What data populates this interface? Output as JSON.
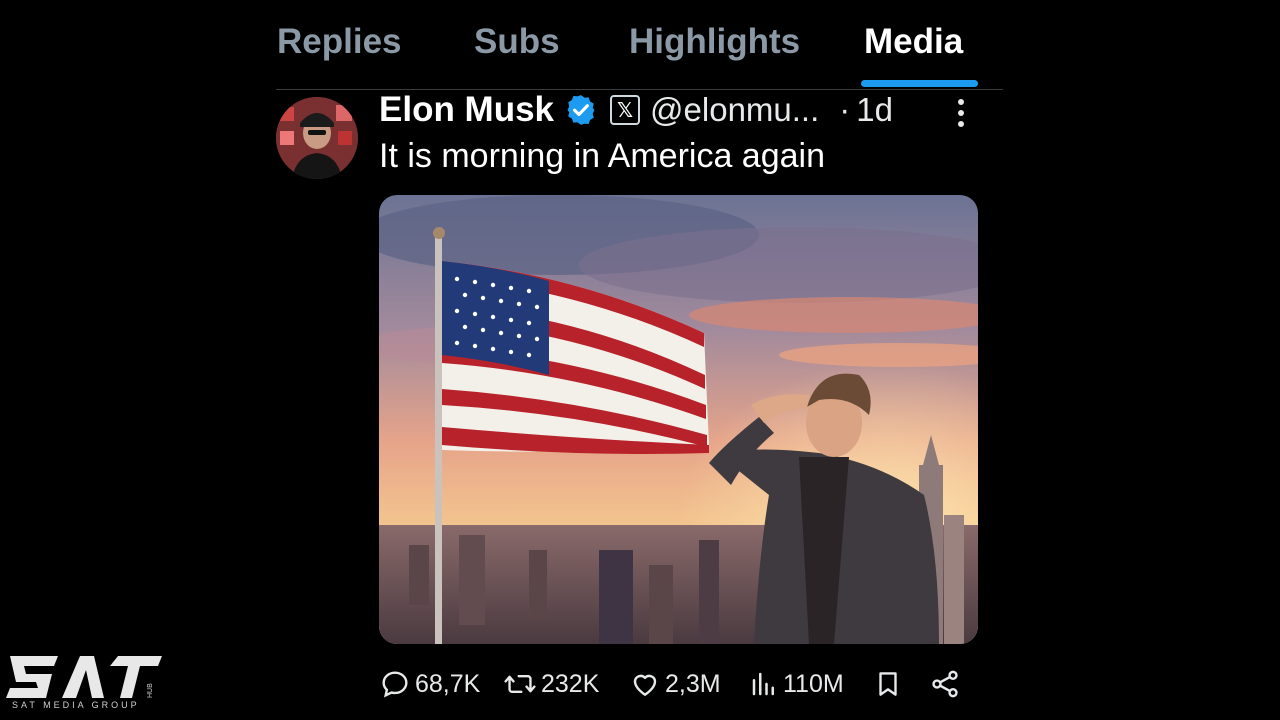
{
  "tabs": [
    {
      "label": "Replies"
    },
    {
      "label": "Subs"
    },
    {
      "label": "Highlights"
    },
    {
      "label": "Media",
      "active": true
    }
  ],
  "tweet": {
    "author_name": "Elon Musk",
    "handle": "@elonmu...",
    "separator": "·",
    "time": "1d",
    "text": "It is morning in America again",
    "badge_icon": "x-logo-icon",
    "verified_icon": "verified-badge-icon",
    "verified_color": "#1d9bf0"
  },
  "actions": {
    "replies": "68,7K",
    "reposts": "232K",
    "likes": "2,3M",
    "views": "110M"
  },
  "watermark": {
    "logo_text": "SAT",
    "hub_text": "HUB",
    "tagline": "SAT MEDIA GROUP"
  },
  "colors": {
    "accent": "#1d9bf0",
    "background": "#000000",
    "text": "#e7e9ea"
  }
}
